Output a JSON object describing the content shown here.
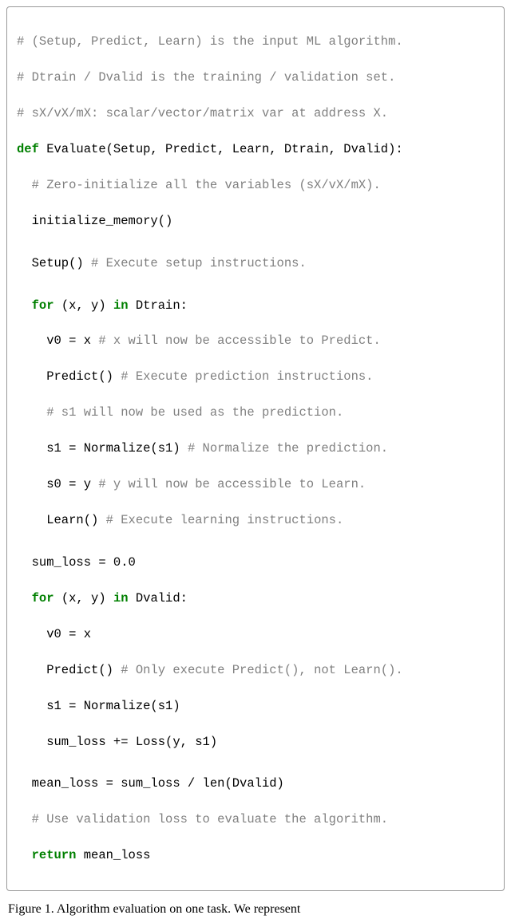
{
  "code": {
    "l1": "# (Setup, Predict, Learn) is the input ML algorithm.",
    "l2": "# Dtrain / Dvalid is the training / validation set.",
    "l3": "# sX/vX/mX: scalar/vector/matrix var at address X.",
    "l4_kw": "def",
    "l4_rest": " Evaluate(Setup, Predict, Learn, Dtrain, Dvalid):",
    "l5": "  # Zero-initialize all the variables (sX/vX/mX).",
    "l6": "  initialize_memory()",
    "l7a": "  Setup() ",
    "l7b": "# Execute setup instructions.",
    "l8_kw": "  for",
    "l8_mid": " (x, y) ",
    "l8_in": "in",
    "l8_rest": " Dtrain:",
    "l9a": "    v0 = x ",
    "l9b": "# x will now be accessible to Predict.",
    "l10a": "    Predict() ",
    "l10b": "# Execute prediction instructions.",
    "l11": "    # s1 will now be used as the prediction.",
    "l12a": "    s1 = Normalize(s1) ",
    "l12b": "# Normalize the prediction.",
    "l13a": "    s0 = y ",
    "l13b": "# y will now be accessible to Learn.",
    "l14a": "    Learn() ",
    "l14b": "# Execute learning instructions.",
    "l15": "  sum_loss = 0.0",
    "l16_kw": "  for",
    "l16_mid": " (x, y) ",
    "l16_in": "in",
    "l16_rest": " Dvalid:",
    "l17": "    v0 = x",
    "l18a": "    Predict() ",
    "l18b": "# Only execute Predict(), not Learn().",
    "l19": "    s1 = Normalize(s1)",
    "l20": "    sum_loss += Loss(y, s1)",
    "l21": "  mean_loss = sum_loss / len(Dvalid)",
    "l22": "  # Use validation loss to evaluate the algorithm.",
    "l23_kw": "  return",
    "l23_rest": " mean_loss"
  },
  "caption": "Figure 1.  Algorithm evaluation on one task.  We represent"
}
